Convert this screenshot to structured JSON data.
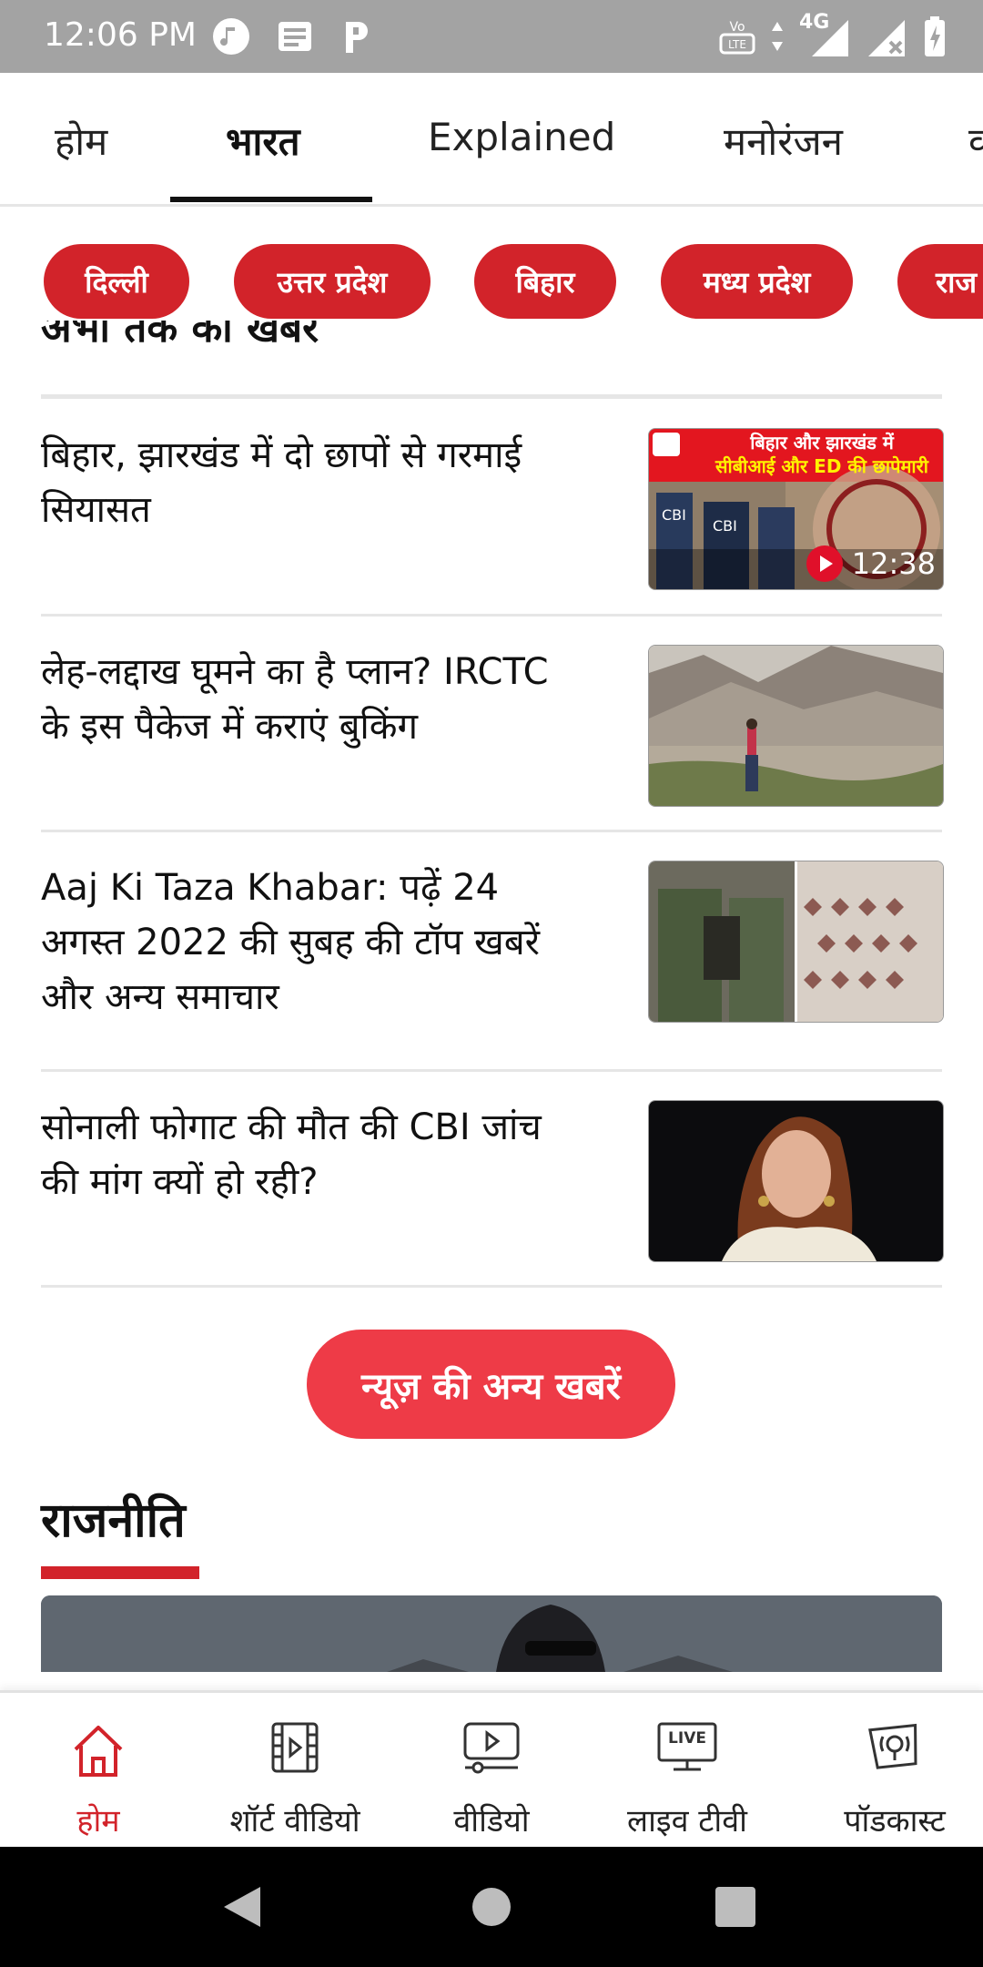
{
  "status_bar": {
    "time": "12:06 PM",
    "left_icons": [
      "music-icon",
      "news-icon",
      "p-icon"
    ],
    "right_icons": [
      "volte-icon",
      "data-arrows-icon",
      "network-4g-icon",
      "signal-icon",
      "signal-x-icon",
      "battery-charging-icon"
    ],
    "network_label": "4G",
    "volte_label": "Vo LTE"
  },
  "tabs": [
    {
      "label": "होम"
    },
    {
      "label": "भारत",
      "active": true
    },
    {
      "label": "Explained"
    },
    {
      "label": "मनोरंजन"
    },
    {
      "label": "व"
    }
  ],
  "chips": [
    {
      "label": "दिल्ली"
    },
    {
      "label": "उत्तर प्रदेश"
    },
    {
      "label": "बिहार"
    },
    {
      "label": "मध्य प्रदेश"
    },
    {
      "label": "राज"
    }
  ],
  "partial_heading": "अभी तक की खबरें",
  "news": [
    {
      "title": "बिहार, झारखंड में दो छापों से गरमाई सियासत",
      "thumb_caption_line1": "बिहार और झारखंड में",
      "thumb_caption_line2": "सीबीआई और ED की छापेमारी",
      "duration": "12:38",
      "is_video": true
    },
    {
      "title": "लेह-लद्दाख घूमने का है प्लान? IRCTC के इस पैकेज में कराएं बुकिंग"
    },
    {
      "title": "Aaj Ki Taza Khabar: पढ़ें 24 अगस्त 2022 की सुबह की टॉप खबरें और अन्य समाचार"
    },
    {
      "title": "सोनाली फोगाट की मौत की CBI जांच की मांग क्यों हो रही?"
    }
  ],
  "more_button_label": "न्यूज़ की अन्य खबरें",
  "section_title": "राजनीति",
  "bottom_nav": [
    {
      "label": "होम",
      "icon": "home-icon",
      "active": true
    },
    {
      "label": "शॉर्ट वीडियो",
      "icon": "short-video-icon"
    },
    {
      "label": "वीडियो",
      "icon": "video-icon"
    },
    {
      "label": "लाइव टीवी",
      "icon": "live-tv-icon",
      "badge": "LIVE"
    },
    {
      "label": "पॉडकास्ट",
      "icon": "podcast-icon"
    }
  ],
  "colors": {
    "accent_red": "#d2232a",
    "button_red": "#ee3b47",
    "status_bar": "#a3a3a3"
  }
}
